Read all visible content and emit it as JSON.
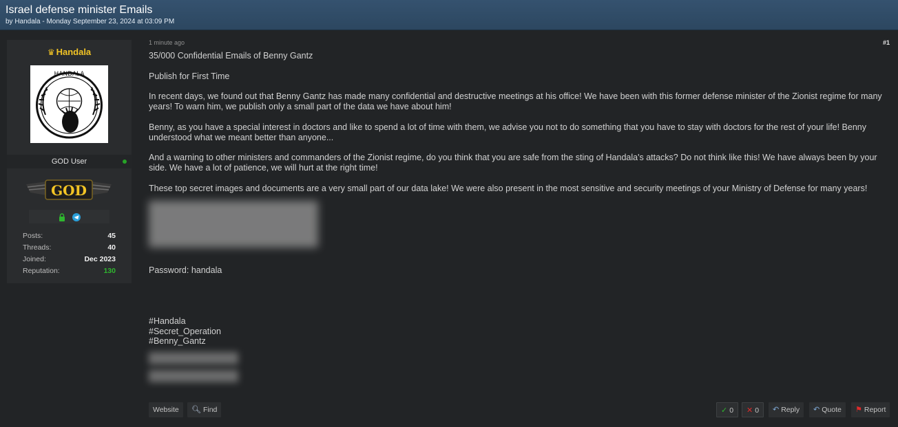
{
  "thread": {
    "title": "Israel defense minister Emails",
    "byline": "by Handala - Monday September 23, 2024 at 03:09 PM"
  },
  "user": {
    "name": "Handala",
    "crown_icon": "crown-icon",
    "avatar_text": "HANDALA",
    "title": "GOD User",
    "rank_badge": "GOD",
    "stats": [
      {
        "label": "Posts:",
        "value": "45"
      },
      {
        "label": "Threads:",
        "value": "40"
      },
      {
        "label": "Joined:",
        "value": "Dec 2023"
      },
      {
        "label": "Reputation:",
        "value": "130"
      }
    ],
    "colors": {
      "name": "#f2c425",
      "reputation": "#2fb62f",
      "online": "#27a327"
    }
  },
  "post": {
    "time": "1 minute ago",
    "number": "#1",
    "paragraphs": [
      "35/000 Confidential Emails of Benny Gantz",
      "Publish for First Time",
      "In recent days, we found out that Benny Gantz has made many confidential and destructive meetings at his office! We have been with this former defense minister of the Zionist regime for many years! To warn him, we publish only a small part of the data we have about him!",
      "Benny, as you have a special interest in doctors and like to spend a lot of time with them, we advise you not to do something that you have to stay with doctors for the rest of your life! Benny understood what we meant better than anyone...",
      "And a warning to other ministers and commanders of the Zionist regime, do you think that you are safe from the sting of Handala's attacks? Do not think like this! We have always been by your side. We have a lot of patience, we will hurt at the right time!",
      "These top secret images and documents are a very small part of our data lake! We were also present in the most sensitive and security meetings of your Ministry of Defense for many years!"
    ],
    "password": "Password: handala",
    "hashtags": [
      "#Handala",
      "#Secret_Operation",
      "#Benny_Gantz"
    ]
  },
  "footer": {
    "website": "Website",
    "find": "Find",
    "upvotes": "0",
    "downvotes": "0",
    "reply": "Reply",
    "quote": "Quote",
    "report": "Report"
  }
}
